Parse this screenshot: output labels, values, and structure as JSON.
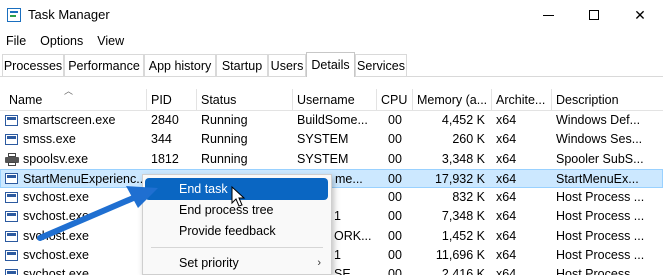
{
  "window": {
    "title": "Task Manager",
    "minimize_icon": "minimize-icon",
    "maximize_icon": "maximize-icon",
    "close_label": "✕"
  },
  "menu": [
    "File",
    "Options",
    "View"
  ],
  "tabs": [
    {
      "label": "Processes"
    },
    {
      "label": "Performance"
    },
    {
      "label": "App history"
    },
    {
      "label": "Startup"
    },
    {
      "label": "Users"
    },
    {
      "label": "Details",
      "active": true
    },
    {
      "label": "Services"
    }
  ],
  "columns": [
    "Name",
    "PID",
    "Status",
    "Username",
    "CPU",
    "Memory (a...",
    "Archite...",
    "Description"
  ],
  "rows": [
    [
      "smartscreen.exe",
      "2840",
      "Running",
      "BuildSome...",
      "00",
      "4,452 K",
      "x64",
      "Windows Def..."
    ],
    [
      "smss.exe",
      "344",
      "Running",
      "SYSTEM",
      "00",
      "260 K",
      "x64",
      "Windows Ses..."
    ],
    [
      "spoolsv.exe",
      "1812",
      "Running",
      "SYSTEM",
      "00",
      "3,348 K",
      "x64",
      "Spooler SubS..."
    ],
    [
      "StartMenuExperienc...",
      "",
      "",
      "me...",
      "00",
      "17,932 K",
      "x64",
      "StartMenuEx..."
    ],
    [
      "svchost.exe",
      "",
      "",
      "",
      "00",
      "832 K",
      "x64",
      "Host Process ..."
    ],
    [
      "svchost.exe",
      "",
      "",
      "1",
      "00",
      "7,348 K",
      "x64",
      "Host Process ..."
    ],
    [
      "svchost.exe",
      "",
      "",
      "ORK...",
      "00",
      "1,452 K",
      "x64",
      "Host Process ..."
    ],
    [
      "svchost.exe",
      "",
      "",
      "1",
      "00",
      "11,696 K",
      "x64",
      "Host Process ..."
    ],
    [
      "svchost.exe",
      "",
      "",
      "SE",
      "00",
      "2,416 K",
      "x64",
      "Host Process ..."
    ]
  ],
  "row_icons": [
    "process-icon",
    "process-icon",
    "printer-icon",
    "process-icon",
    "process-icon",
    "process-icon",
    "process-icon",
    "process-icon",
    "process-icon"
  ],
  "selected_row": 3,
  "context_menu": {
    "items": [
      "End task",
      "End process tree",
      "Provide feedback",
      "Set priority"
    ],
    "highlighted": "End task",
    "submenu_arrow": "›"
  },
  "colors": {
    "selection": "#cce8ff",
    "menu_highlight": "#0a66c2",
    "annotation_arrow": "#1f6fd1"
  }
}
